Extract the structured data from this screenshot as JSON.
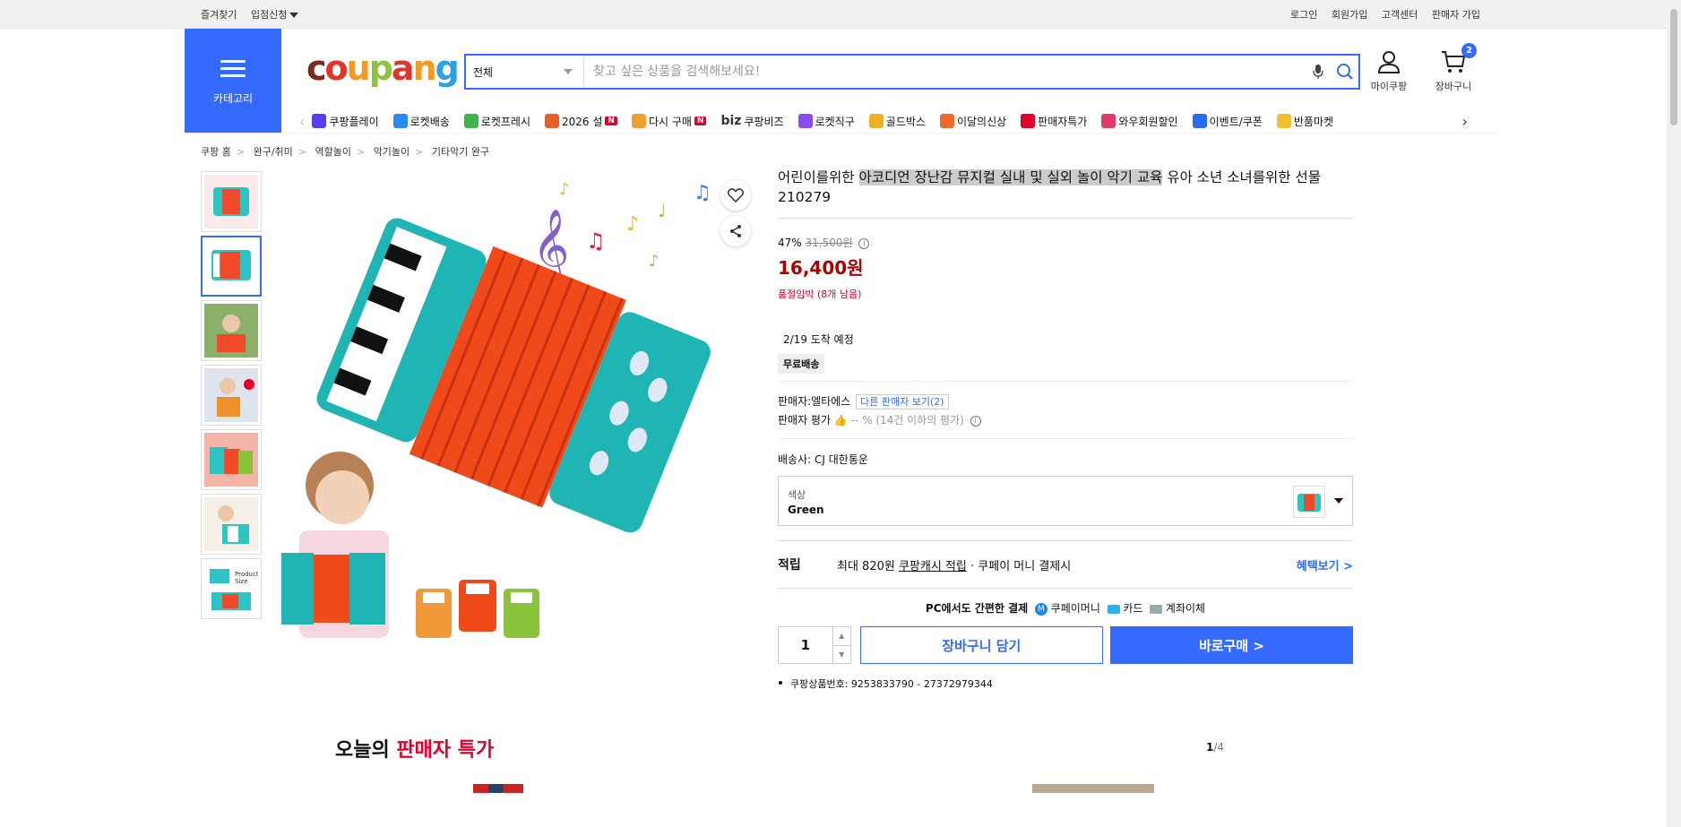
{
  "topbar": {
    "left": [
      "즐겨찾기",
      "입점신청"
    ],
    "right": [
      "로그인",
      "회원가입",
      "고객센터",
      "판매자 가입"
    ]
  },
  "header": {
    "category_label": "카테고리",
    "logo": "coupang",
    "search": {
      "scope": "전체",
      "placeholder": "찾고 싶은 상품을 검색해보세요!"
    },
    "mycoupang": "마이쿠팡",
    "cart": "장바구니",
    "cart_count": "2"
  },
  "nav": [
    {
      "label": "쿠팡플레이",
      "color": "#5a3cf0"
    },
    {
      "label": "로켓배송",
      "color": "#2a8af0"
    },
    {
      "label": "로켓프레시",
      "color": "#3cb44a"
    },
    {
      "label": "2026 설",
      "color": "#e4602b",
      "badge": "N"
    },
    {
      "label": "다시 구매",
      "color": "#f0a030",
      "badge": "N"
    },
    {
      "label": "쿠팡비즈",
      "prefix": "biz",
      "color": "#333"
    },
    {
      "label": "로켓직구",
      "color": "#8a4cf0"
    },
    {
      "label": "골드박스",
      "color": "#f0b020"
    },
    {
      "label": "이달의신상",
      "color": "#f06a2a"
    },
    {
      "label": "판매자특가",
      "color": "#e4002b"
    },
    {
      "label": "와우회원할인",
      "color": "#e43a6a"
    },
    {
      "label": "이벤트/쿠폰",
      "color": "#2a6af0"
    },
    {
      "label": "반품마켓",
      "color": "#f0c030"
    }
  ],
  "breadcrumb": [
    "쿠팡 홈",
    "완구/취미",
    "역할놀이",
    "악기놀이",
    "기타악기 완구"
  ],
  "product": {
    "title_pre": "어린이를위한 ",
    "title_highlight": "아코디언 장난감 뮤지컬 실내 및 실외 놀이 악기 교육",
    "title_post": " 유아 소년 소녀를위한 선물 210279",
    "discount": "47%",
    "original_price": "31,500원",
    "price": "16,400원",
    "stock": "품절임박 (8개 남음)",
    "arrival": "2/19 도착 예정",
    "free_shipping": "무료배송",
    "seller_label": "판매자:",
    "seller_name": "엘타에스",
    "other_sellers": "다른 판매자 보기(2)",
    "seller_rating_label": "판매자 평가",
    "seller_rating_value": "-- % (14건 이하의 평가)",
    "courier_label": "배송사:",
    "courier": "CJ 대한통운",
    "option_label": "색상",
    "option_value": "Green",
    "reward_label": "적립",
    "reward_pre": "최대 820원 ",
    "reward_link": "쿠팡캐시 적립",
    "reward_post": " · 쿠페이 머니 결제시",
    "reward_more": "혜택보기 >",
    "pay_label": "PC에서도 간편한 결제",
    "pay_methods": [
      "쿠페이머니",
      "카드",
      "계좌이체"
    ],
    "quantity": "1",
    "cart_button": "장바구니 담기",
    "buy_button": "바로구매 >",
    "product_number": "쿠팡상품번호: 9253833790 - 27372979344"
  },
  "deals": {
    "title_pre": "오늘의 ",
    "title_red": "판매자 특가",
    "page_current": "1",
    "page_total": "/4"
  }
}
